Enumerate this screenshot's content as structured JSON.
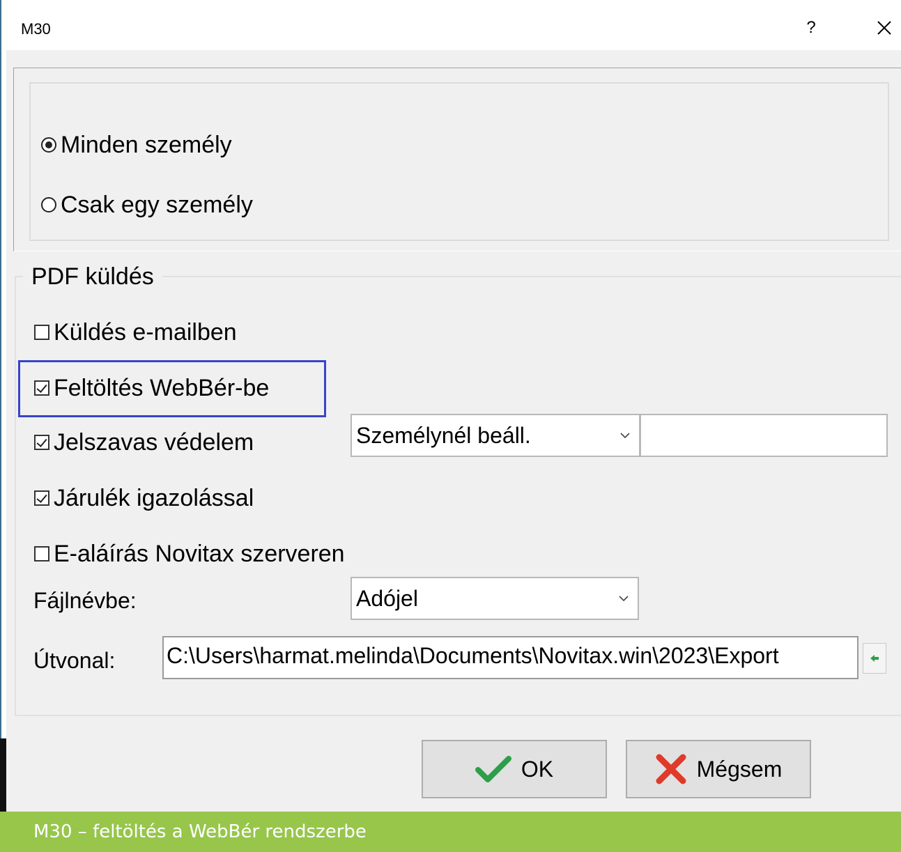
{
  "window": {
    "title": "M30",
    "help_label": "?"
  },
  "scope": {
    "options": [
      {
        "label": "Minden személy",
        "checked": true
      },
      {
        "label": "Csak egy személy",
        "checked": false
      }
    ]
  },
  "pdf": {
    "legend": "PDF küldés",
    "checkboxes": [
      {
        "label": "Küldés e-mailben",
        "checked": false
      },
      {
        "label": "Feltöltés WebBér-be",
        "checked": true
      },
      {
        "label": "Jelszavas védelem",
        "checked": true
      },
      {
        "label": "Járulék igazolással",
        "checked": true
      },
      {
        "label": "E-aláírás Novitax szerveren",
        "checked": false
      }
    ],
    "password_mode": "Személynél beáll.",
    "password_value": "",
    "filename_label": "Fájlnévbe:",
    "filename_value": "Adójel",
    "path_label": "Útvonal:",
    "path_value": "C:\\Users\\harmat.melinda\\Documents\\Novitax.win\\2023\\Export"
  },
  "buttons": {
    "ok": "OK",
    "cancel": "Mégsem"
  },
  "caption": "M30 – feltöltés a WebBér rendszerbe",
  "colors": {
    "highlight": "#3844c8",
    "ok_check": "#2e9e4a",
    "cancel_x": "#e03a2a",
    "caption_bg": "#97c64b"
  }
}
